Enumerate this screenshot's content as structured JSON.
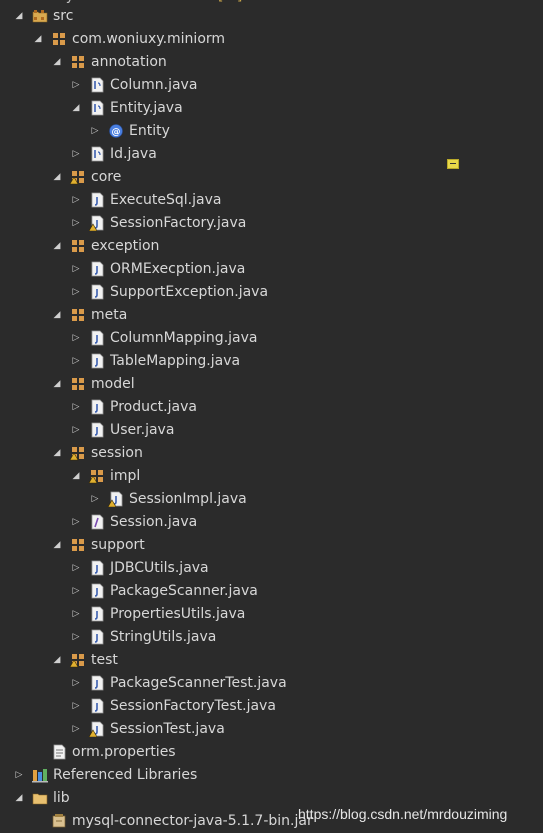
{
  "top_partial": {
    "text_left": "ry",
    "text_right": "[...]"
  },
  "tree": [
    {
      "id": "src",
      "label": "src",
      "depth": 0,
      "state": "expanded",
      "icon": "source-folder-icon"
    },
    {
      "id": "pkg-miniorm",
      "label": "com.woniuxy.miniorm",
      "depth": 1,
      "state": "expanded",
      "icon": "package-icon"
    },
    {
      "id": "pkg-annotation",
      "label": "annotation",
      "depth": 2,
      "state": "expanded",
      "icon": "package-icon"
    },
    {
      "id": "file-column",
      "label": "Column.java",
      "depth": 3,
      "state": "collapsed",
      "icon": "java-annotation-file-icon"
    },
    {
      "id": "file-entity",
      "label": "Entity.java",
      "depth": 3,
      "state": "expanded",
      "icon": "java-annotation-file-icon"
    },
    {
      "id": "type-entity",
      "label": "Entity",
      "depth": 4,
      "state": "collapsed",
      "icon": "annotation-type-icon"
    },
    {
      "id": "file-id",
      "label": "Id.java",
      "depth": 3,
      "state": "collapsed",
      "icon": "java-annotation-file-icon"
    },
    {
      "id": "pkg-core",
      "label": "core",
      "depth": 2,
      "state": "expanded",
      "icon": "package-warning-icon"
    },
    {
      "id": "file-executesql",
      "label": "ExecuteSql.java",
      "depth": 3,
      "state": "collapsed",
      "icon": "java-file-icon"
    },
    {
      "id": "file-sessionfactory",
      "label": "SessionFactory.java",
      "depth": 3,
      "state": "collapsed",
      "icon": "java-file-warning-icon"
    },
    {
      "id": "pkg-exception",
      "label": "exception",
      "depth": 2,
      "state": "expanded",
      "icon": "package-icon"
    },
    {
      "id": "file-ormexecption",
      "label": "ORMExecption.java",
      "depth": 3,
      "state": "collapsed",
      "icon": "java-file-icon"
    },
    {
      "id": "file-supportexception",
      "label": "SupportException.java",
      "depth": 3,
      "state": "collapsed",
      "icon": "java-file-icon"
    },
    {
      "id": "pkg-meta",
      "label": "meta",
      "depth": 2,
      "state": "expanded",
      "icon": "package-icon"
    },
    {
      "id": "file-columnmapping",
      "label": "ColumnMapping.java",
      "depth": 3,
      "state": "collapsed",
      "icon": "java-file-icon"
    },
    {
      "id": "file-tablemapping",
      "label": "TableMapping.java",
      "depth": 3,
      "state": "collapsed",
      "icon": "java-file-icon"
    },
    {
      "id": "pkg-model",
      "label": "model",
      "depth": 2,
      "state": "expanded",
      "icon": "package-icon"
    },
    {
      "id": "file-product",
      "label": "Product.java",
      "depth": 3,
      "state": "collapsed",
      "icon": "java-file-icon"
    },
    {
      "id": "file-user",
      "label": "User.java",
      "depth": 3,
      "state": "collapsed",
      "icon": "java-file-icon"
    },
    {
      "id": "pkg-session",
      "label": "session",
      "depth": 2,
      "state": "expanded",
      "icon": "package-warning-icon"
    },
    {
      "id": "pkg-impl",
      "label": "impl",
      "depth": 3,
      "state": "expanded",
      "icon": "package-warning-icon"
    },
    {
      "id": "file-sessionimpl",
      "label": "SessionImpl.java",
      "depth": 4,
      "state": "collapsed",
      "icon": "java-file-warning-icon"
    },
    {
      "id": "file-session",
      "label": "Session.java",
      "depth": 3,
      "state": "collapsed",
      "icon": "java-interface-file-icon"
    },
    {
      "id": "pkg-support",
      "label": "support",
      "depth": 2,
      "state": "expanded",
      "icon": "package-icon"
    },
    {
      "id": "file-jdbcutils",
      "label": "JDBCUtils.java",
      "depth": 3,
      "state": "collapsed",
      "icon": "java-file-icon"
    },
    {
      "id": "file-packagescanner",
      "label": "PackageScanner.java",
      "depth": 3,
      "state": "collapsed",
      "icon": "java-file-icon"
    },
    {
      "id": "file-propertiesutils",
      "label": "PropertiesUtils.java",
      "depth": 3,
      "state": "collapsed",
      "icon": "java-file-icon"
    },
    {
      "id": "file-stringutils",
      "label": "StringUtils.java",
      "depth": 3,
      "state": "collapsed",
      "icon": "java-file-icon"
    },
    {
      "id": "pkg-test",
      "label": "test",
      "depth": 2,
      "state": "expanded",
      "icon": "package-warning-icon"
    },
    {
      "id": "file-packagescannertest",
      "label": "PackageScannerTest.java",
      "depth": 3,
      "state": "collapsed",
      "icon": "java-file-icon"
    },
    {
      "id": "file-sessionfactorytest",
      "label": "SessionFactoryTest.java",
      "depth": 3,
      "state": "collapsed",
      "icon": "java-file-icon"
    },
    {
      "id": "file-sessiontest",
      "label": "SessionTest.java",
      "depth": 3,
      "state": "collapsed",
      "icon": "java-file-warning-icon"
    },
    {
      "id": "file-orm-properties",
      "label": "orm.properties",
      "depth": 1,
      "state": "none",
      "icon": "properties-file-icon"
    },
    {
      "id": "referenced-libraries",
      "label": "Referenced Libraries",
      "depth": 0,
      "state": "collapsed",
      "icon": "library-icon"
    },
    {
      "id": "folder-lib",
      "label": "lib",
      "depth": 0,
      "state": "expanded",
      "icon": "folder-icon"
    },
    {
      "id": "jar-mysql",
      "label": "mysql-connector-java-5.1.7-bin.jar",
      "depth": 1,
      "state": "none",
      "icon": "jar-file-icon"
    }
  ],
  "watermark": "https://blog.csdn.net/mrdouziming",
  "colors": {
    "background": "#2b2b2b",
    "text": "#d7d7d7",
    "package": "#d99a4a",
    "java_file": "#e8e8e8",
    "annotation": "#4a7fe0",
    "warning": "#e0b030"
  }
}
